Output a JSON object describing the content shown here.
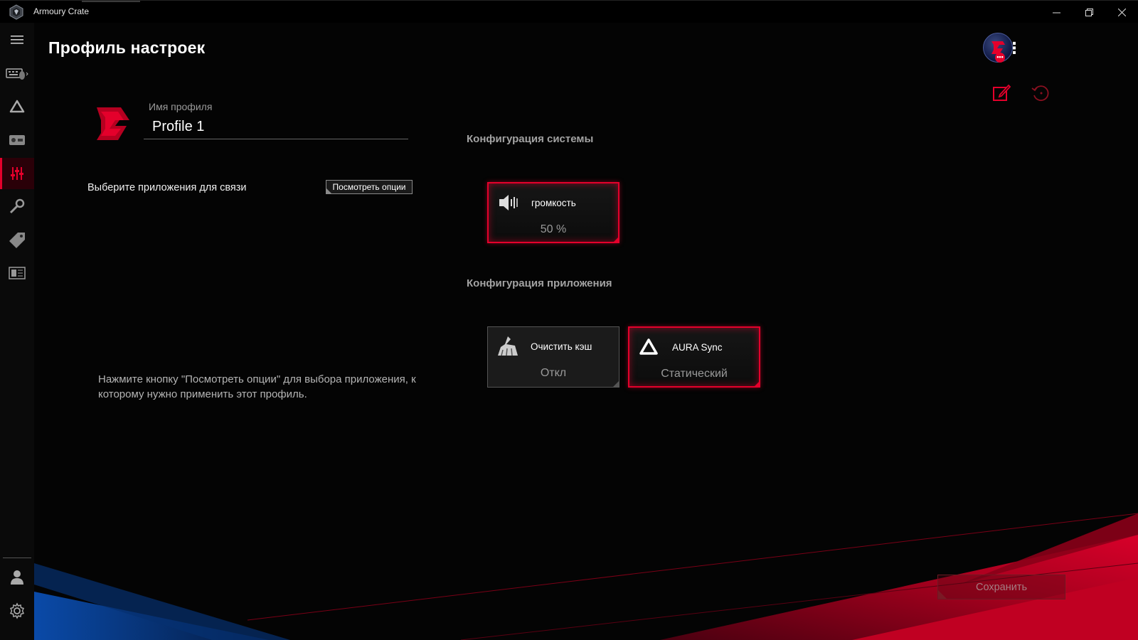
{
  "window": {
    "title": "Armoury Crate",
    "minimize": "—",
    "maximize": "❐",
    "close": "✕"
  },
  "sidebar": {
    "items": [
      {
        "name": "menu-icon",
        "active": false
      },
      {
        "name": "devices-icon",
        "active": false
      },
      {
        "name": "aura-icon",
        "active": false
      },
      {
        "name": "game-visual-icon",
        "active": false
      },
      {
        "name": "scenario-profiles-icon",
        "active": true
      },
      {
        "name": "tools-icon",
        "active": false
      },
      {
        "name": "deals-icon",
        "active": false
      },
      {
        "name": "news-icon",
        "active": false
      }
    ],
    "bottom": [
      {
        "name": "user-center-icon"
      },
      {
        "name": "settings-icon"
      }
    ]
  },
  "header": {
    "title": "Профиль настроек",
    "avatar_badge": "•••",
    "more": "⋮"
  },
  "profile": {
    "name_label": "Имя профиля",
    "name_value": "Profile 1"
  },
  "apps": {
    "select_label": "Выберите приложения для связи",
    "view_options_button": "Посмотреть опции",
    "hint": "Нажмите кнопку \"Посмотреть опции\" для выбора приложения, к которому нужно применить этот профиль."
  },
  "system_config": {
    "title": "Конфигурация системы",
    "cards": [
      {
        "title": "громкость",
        "value": "50 %",
        "icon": "speaker-icon"
      }
    ]
  },
  "app_config": {
    "title": "Конфигурация приложения",
    "cards": [
      {
        "title": "Очистить кэш",
        "value": "Откл",
        "icon": "clear-cache-icon"
      },
      {
        "title": "AURA Sync",
        "value": "Статический",
        "icon": "aura-sync-icon"
      }
    ]
  },
  "footer": {
    "save_button": "Сохранить"
  },
  "colors": {
    "accent": "#e4002b",
    "background": "#000000",
    "blue_art": "#0a4aa8"
  }
}
